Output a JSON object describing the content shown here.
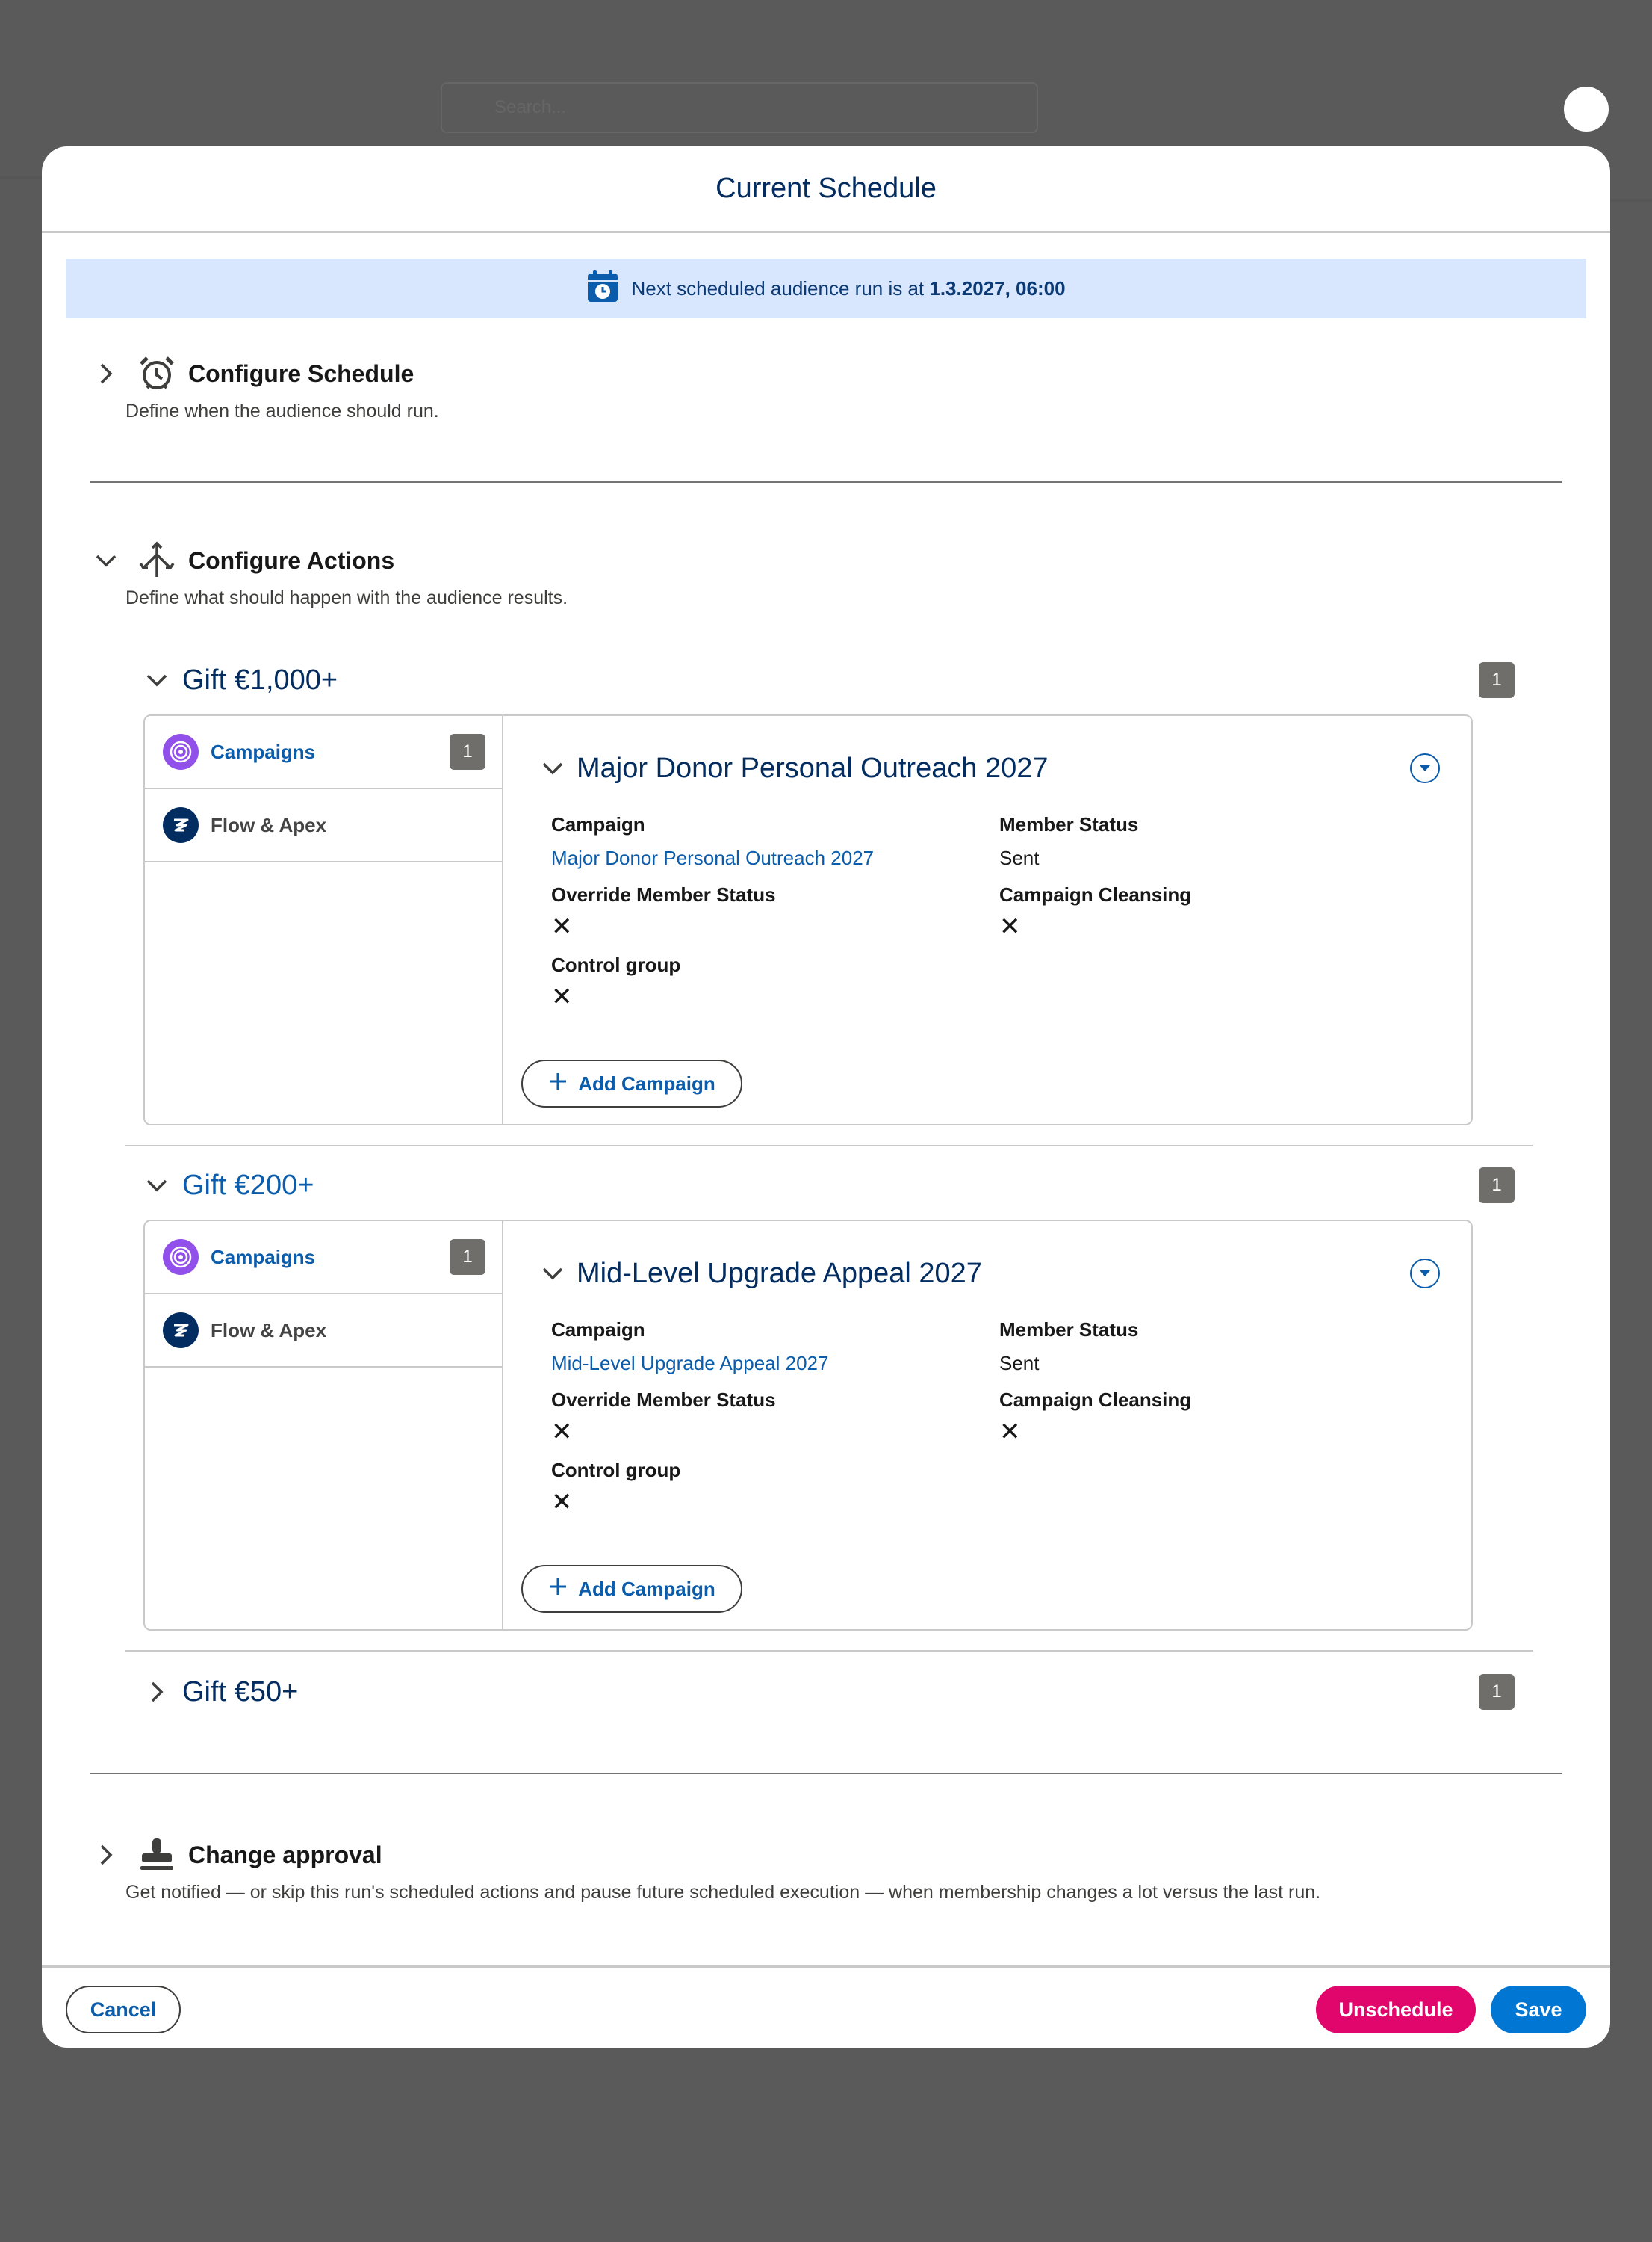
{
  "background": {
    "search_placeholder": "Search..."
  },
  "modal": {
    "title": "Current Schedule"
  },
  "banner": {
    "text_prefix": "Next scheduled audience run is at ",
    "datetime": "1.3.2027, 06:00"
  },
  "schedule": {
    "title": "Configure Schedule",
    "description": "Define when the audience should run."
  },
  "actions": {
    "title": "Configure Actions",
    "description": "Define what should happen with the audience results.",
    "groups": [
      {
        "title": "Gift €1,000+",
        "count": "1",
        "nav": [
          {
            "label": "Campaigns",
            "count": "1"
          },
          {
            "label": "Flow & Apex"
          }
        ],
        "campaign": {
          "title": "Major Donor Personal Outreach 2027",
          "campaign_label": "Campaign",
          "campaign_value": "Major Donor Personal Outreach 2027",
          "member_status_label": "Member Status",
          "member_status_value": "Sent",
          "override_label": "Override Member Status",
          "override_value": "✕",
          "cleansing_label": "Campaign Cleansing",
          "cleansing_value": "✕",
          "control_label": "Control group",
          "control_value": "✕"
        },
        "add_label": "Add Campaign"
      },
      {
        "title": "Gift €200+",
        "count": "1",
        "nav": [
          {
            "label": "Campaigns",
            "count": "1"
          },
          {
            "label": "Flow & Apex"
          }
        ],
        "campaign": {
          "title": "Mid-Level Upgrade Appeal 2027",
          "campaign_label": "Campaign",
          "campaign_value": "Mid-Level Upgrade Appeal 2027",
          "member_status_label": "Member Status",
          "member_status_value": "Sent",
          "override_label": "Override Member Status",
          "override_value": "✕",
          "cleansing_label": "Campaign Cleansing",
          "cleansing_value": "✕",
          "control_label": "Control group",
          "control_value": "✕"
        },
        "add_label": "Add Campaign"
      },
      {
        "title": "Gift €50+",
        "count": "1"
      }
    ]
  },
  "approval": {
    "title": "Change approval",
    "description": "Get notified — or skip this run's scheduled actions and pause future scheduled execution — when membership changes a lot versus the last run."
  },
  "footer": {
    "cancel_label": "Cancel",
    "unschedule_label": "Unschedule",
    "save_label": "Save"
  },
  "colors": {
    "brand_blue": "#0176d3",
    "link_blue": "#0b5cab",
    "title_navy": "#032d60",
    "unschedule_pink": "#e0066b",
    "banner_bg": "#d8e6fe"
  }
}
